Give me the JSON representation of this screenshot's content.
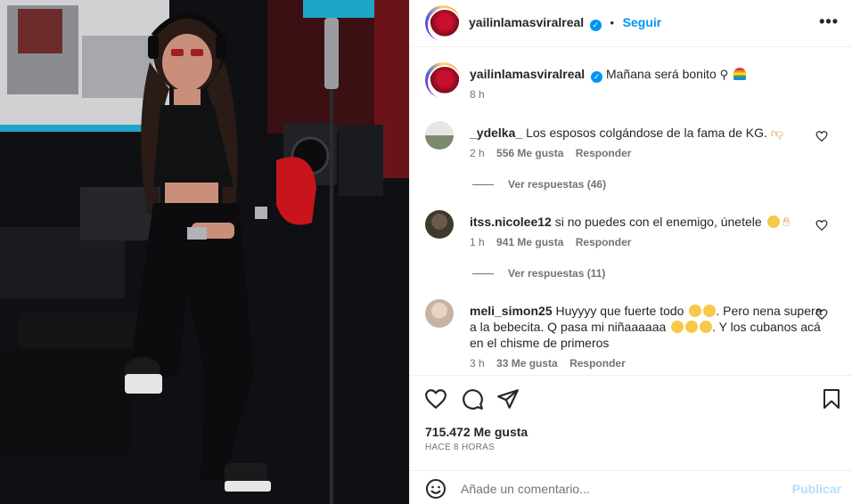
{
  "post": {
    "author": "yailinlamasviralreal",
    "follow_label": "Seguir",
    "dot": "•",
    "more_label": "•••",
    "caption": "Mañana será bonito",
    "caption_time": "8 h",
    "likes": "715.472 Me gusta",
    "posted": "HACE 8 HORAS"
  },
  "comments": [
    {
      "user": "_ydelka_",
      "text": "Los esposos colgándose de la fama de KG.",
      "time": "2 h",
      "likes": "556 Me gusta",
      "reply": "Responder",
      "view_replies": "Ver respuestas (46)"
    },
    {
      "user": "itss.nicolee12",
      "text": "si no puedes con el enemigo, únetele",
      "time": "1 h",
      "likes": "941 Me gusta",
      "reply": "Responder",
      "view_replies": "Ver respuestas (11)"
    },
    {
      "user": "meli_simon25",
      "text_a": "Huyyyy que fuerte todo",
      "text_b": ". Pero nena supera a la bebecita. Q pasa mi niñaaaaaa",
      "text_c": ". Y los cubanos acá en el chisme de primeros",
      "time": "3 h",
      "likes": "33 Me gusta",
      "reply": "Responder"
    }
  ],
  "add_comment": {
    "placeholder": "Añade un comentario...",
    "publish": "Publicar"
  },
  "icons": {
    "verified": "verified-badge-icon",
    "like": "heart-icon",
    "comment": "comment-bubble-icon",
    "share": "paper-plane-icon",
    "save": "bookmark-icon",
    "emoji": "smiley-icon"
  },
  "colors": {
    "accent": "#0095f6",
    "publish_disabled": "#b2dffc",
    "muted": "#737373",
    "text": "#262626"
  }
}
